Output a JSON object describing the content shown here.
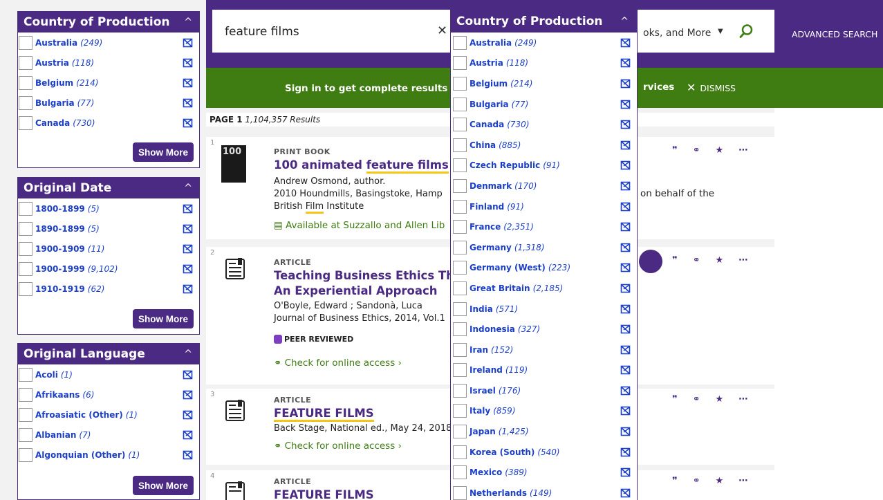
{
  "left_facets": [
    {
      "title": "Country of Production",
      "items": [
        {
          "name": "Australia",
          "count": "(249)"
        },
        {
          "name": "Austria",
          "count": "(118)"
        },
        {
          "name": "Belgium",
          "count": "(214)"
        },
        {
          "name": "Bulgaria",
          "count": "(77)"
        },
        {
          "name": "Canada",
          "count": "(730)"
        }
      ],
      "show_more": "Show More"
    },
    {
      "title": "Original Date",
      "items": [
        {
          "name": "1800-1899",
          "count": "(5)"
        },
        {
          "name": "1890-1899",
          "count": "(5)"
        },
        {
          "name": "1900-1909",
          "count": "(11)"
        },
        {
          "name": "1900-1999",
          "count": "(9,102)"
        },
        {
          "name": "1910-1919",
          "count": "(62)"
        }
      ],
      "show_more": "Show More"
    },
    {
      "title": "Original Language",
      "items": [
        {
          "name": "Acoli",
          "count": "(1)"
        },
        {
          "name": "Afrikaans",
          "count": "(6)"
        },
        {
          "name": "Afroasiatic (Other)",
          "count": "(1)"
        },
        {
          "name": "Albanian",
          "count": "(7)"
        },
        {
          "name": "Algonquian (Other)",
          "count": "(1)"
        }
      ],
      "show_more": "Show More"
    }
  ],
  "search": {
    "query": "feature films",
    "scope": "oks, and More",
    "advanced": "ADVANCED SEARCH"
  },
  "banner": {
    "text_left": "Sign in to get complete results ar",
    "text_right": "rvices",
    "dismiss": "DISMISS"
  },
  "results_header": {
    "page": "PAGE 1",
    "count": "1,104,357 Results"
  },
  "results": [
    {
      "num": "1",
      "type": "PRINT BOOK",
      "title_pre": "100 animated ",
      "title_hl": "feature films",
      "line1": "Andrew Osmond, author.",
      "line2": "2010 Houndmills, Basingstoke, Hamp",
      "line3_a": "British ",
      "line3_hl": "Film",
      "line3_b": " Institute",
      "right_text": "on behalf of the",
      "availability": "Available at Suzzallo and Allen Lib",
      "thumb_text": "100"
    },
    {
      "num": "2",
      "type": "ARTICLE",
      "title1": "Teaching Business Ethics Thro",
      "title2": "An Experiential Approach",
      "line1": "O'Boyle, Edward ; Sandonà, Luca",
      "line2": "Journal of Business Ethics, 2014, Vol.1",
      "peer": "PEER REVIEWED",
      "check": "Check for online access"
    },
    {
      "num": "3",
      "type": "ARTICLE",
      "title": "FEATURE FILMS",
      "line1": "Back Stage, National ed., May 24, 2018",
      "check": "Check for online access"
    },
    {
      "num": "4",
      "type": "ARTICLE",
      "title": "FEATURE FILMS"
    }
  ],
  "action_icons": [
    "quote-icon",
    "link-icon",
    "pin-icon",
    "more-icon"
  ],
  "popup": {
    "title": "Country of Production",
    "items": [
      {
        "name": "Australia",
        "count": "(249)"
      },
      {
        "name": "Austria",
        "count": "(118)"
      },
      {
        "name": "Belgium",
        "count": "(214)"
      },
      {
        "name": "Bulgaria",
        "count": "(77)"
      },
      {
        "name": "Canada",
        "count": "(730)"
      },
      {
        "name": "China",
        "count": "(885)"
      },
      {
        "name": "Czech Republic",
        "count": "(91)"
      },
      {
        "name": "Denmark",
        "count": "(170)"
      },
      {
        "name": "Finland",
        "count": "(91)"
      },
      {
        "name": "France",
        "count": "(2,351)"
      },
      {
        "name": "Germany",
        "count": "(1,318)"
      },
      {
        "name": "Germany (West)",
        "count": "(223)"
      },
      {
        "name": "Great Britain",
        "count": "(2,185)"
      },
      {
        "name": "India",
        "count": "(571)"
      },
      {
        "name": "Indonesia",
        "count": "(327)"
      },
      {
        "name": "Iran",
        "count": "(152)"
      },
      {
        "name": "Ireland",
        "count": "(119)"
      },
      {
        "name": "Israel",
        "count": "(176)"
      },
      {
        "name": "Italy",
        "count": "(859)"
      },
      {
        "name": "Japan",
        "count": "(1,425)"
      },
      {
        "name": "Korea (South)",
        "count": "(540)"
      },
      {
        "name": "Mexico",
        "count": "(389)"
      },
      {
        "name": "Netherlands",
        "count": "(149)"
      }
    ]
  },
  "colors": {
    "brand_purple": "#4b2a83",
    "banner_green": "#3f7d12",
    "link_blue": "#1c3fc8",
    "highlight_yellow": "#f5c518"
  }
}
